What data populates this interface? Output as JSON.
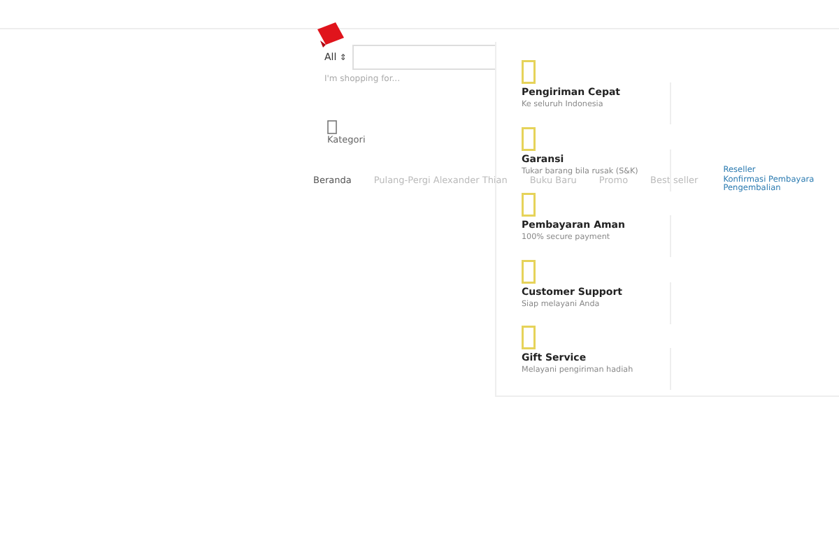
{
  "search": {
    "category": "All",
    "category_arrow": "⇕",
    "placeholder": "I'm shopping for..."
  },
  "category_menu": {
    "label": "Kategori"
  },
  "nav": [
    {
      "label": "Beranda",
      "selected": true
    },
    {
      "label": "Pulang-Pergi Alexander Thian",
      "selected": false
    },
    {
      "label": "Buku Baru",
      "selected": false
    },
    {
      "label": "Promo",
      "selected": false
    },
    {
      "label": "Best seller",
      "selected": false
    }
  ],
  "links": [
    "Reseller",
    "Konfirmasi Pembayara",
    "Pengembalian"
  ],
  "features": [
    {
      "title": "Pengiriman Cepat",
      "subtitle": "Ke seluruh Indonesia"
    },
    {
      "title": "Garansi",
      "subtitle": "Tukar barang bila rusak (S&K)"
    },
    {
      "title": "Pembayaran Aman",
      "subtitle": "100% secure payment"
    },
    {
      "title": "Customer Support",
      "subtitle": "Siap melayani Anda"
    },
    {
      "title": "Gift Service",
      "subtitle": "Melayani pengiriman hadiah"
    }
  ]
}
